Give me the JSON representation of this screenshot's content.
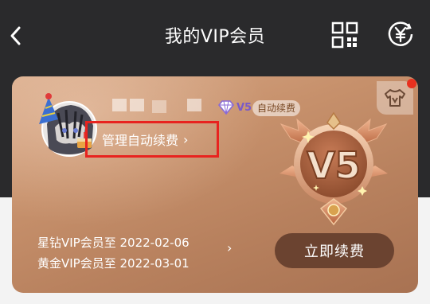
{
  "header": {
    "title": "我的VIP会员",
    "back_icon": "chevron-left-icon",
    "qr_icon": "qr-code-icon",
    "coupon_icon": "yen-coin-icon"
  },
  "card": {
    "vip_level_badge": "V5",
    "auto_renew_badge": "自动续费",
    "manage_auto_renew": "管理自动续费",
    "manage_chevron": "›",
    "emblem_label": "V5",
    "expiry_lines": [
      "星钻VIP会员至 2022-02-06",
      "黄金VIP会员至 2022-03-01"
    ],
    "expiry_chevron": "›",
    "renew_button": "立即续费"
  },
  "colors": {
    "header_bg": "#2a2a2c",
    "card_start": "#d8a988",
    "card_end": "#a87252",
    "renew_button_bg": "#6b4330",
    "highlight_border": "#e8231f",
    "notification_dot": "#e8301e"
  }
}
